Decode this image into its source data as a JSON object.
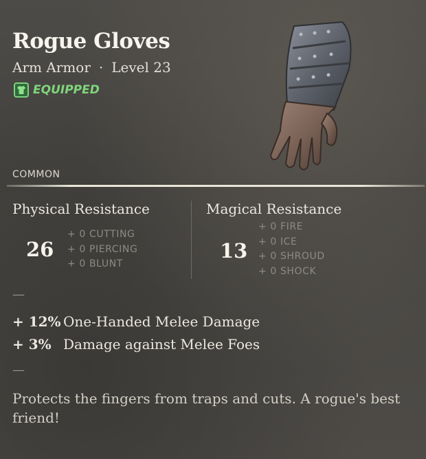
{
  "item": {
    "name": "Rogue Gloves",
    "type": "Arm Armor",
    "separator": "·",
    "level": "Level 23",
    "status": "EQUIPPED",
    "icon": "glove-armor-icon",
    "rarity": "COMMON"
  },
  "physical": {
    "header": "Physical Resistance",
    "value": "26",
    "subs": [
      "+ 0  CUTTING",
      "+ 0  PIERCING",
      "+ 0  BLUNT"
    ]
  },
  "magical": {
    "header": "Magical Resistance",
    "value": "13",
    "subs": [
      "+ 0  FIRE",
      "+ 0  ICE",
      "+ 0  SHROUD",
      "+ 0  SHOCK"
    ]
  },
  "dash": "—",
  "bonuses": [
    {
      "value": "+ 12%",
      "label": "One-Handed Melee Damage"
    },
    {
      "value": "+ 3%",
      "label": "Damage against Melee Foes"
    }
  ],
  "description": "Protects the fingers from traps and cuts. A rogue's best friend!",
  "colors": {
    "equipped": "#7fd47c",
    "background": "#4a4844"
  }
}
